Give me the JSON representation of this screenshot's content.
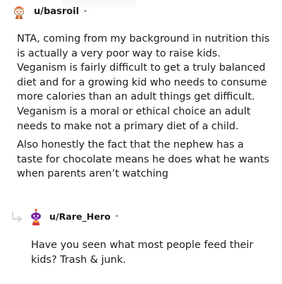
{
  "comment": {
    "username": "u/basroil",
    "separator": "•",
    "paragraphs": [
      "NTA, coming from my background in nutrition this is actually a very poor way to raise kids. Veganism is fairly difficult to get a truly balanced diet and for a growing kid who needs to consume more calories than an adult things get difficult. Veganism is a moral or ethical choice an adult needs to make not a primary diet of a child.",
      "Also honestly the fact that the nephew has a taste for chocolate means he does what he wants when parents aren’t watching"
    ]
  },
  "reply": {
    "username": "u/Rare_Hero",
    "separator": "•",
    "text": "Have you seen what most people feed their kids? Trash & junk."
  },
  "icons": {
    "comment_avatar": "snoo-avatar-icon",
    "reply_avatar": "snoo-avatar-icon",
    "reply_arrow": "reply-arrow-icon"
  },
  "colors": {
    "text": "#1c1c1c",
    "meta": "#7c7c7c",
    "reply_arrow": "#c9cfd6"
  }
}
